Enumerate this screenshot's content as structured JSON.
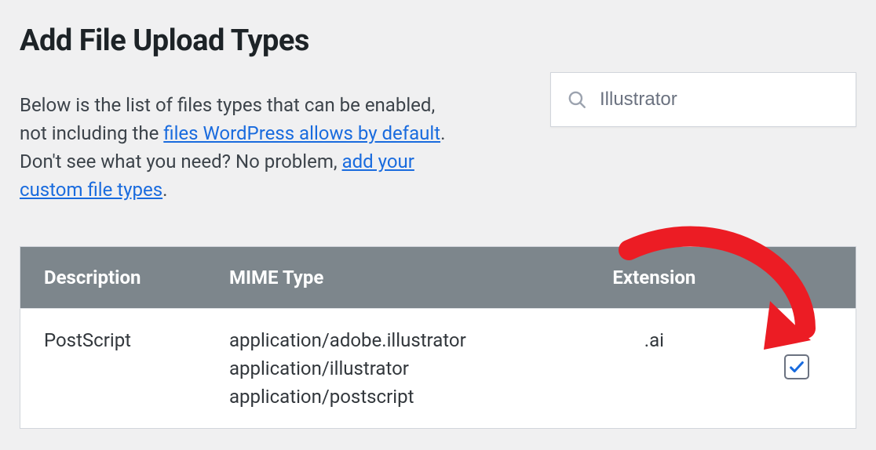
{
  "page": {
    "title": "Add File Upload Types",
    "desc_pre": "Below is the list of files types that can be enabled, not including the ",
    "link1": "files WordPress allows by default",
    "desc_mid": ". Don't see what you need? No problem, ",
    "link2": "add your custom file types",
    "desc_end": "."
  },
  "search": {
    "value": "Illustrator"
  },
  "table": {
    "headers": {
      "desc": "Description",
      "mime": "MIME Type",
      "ext": "Extension"
    },
    "rows": [
      {
        "description": "PostScript",
        "mime_line1": "application/adobe.illustrator",
        "mime_line2": "application/illustrator",
        "mime_line3": "application/postscript",
        "extension": ".ai",
        "checked": true
      }
    ]
  },
  "colors": {
    "link": "#196bde",
    "header_bg": "#7d868c",
    "annotation": "#ec1c24"
  }
}
